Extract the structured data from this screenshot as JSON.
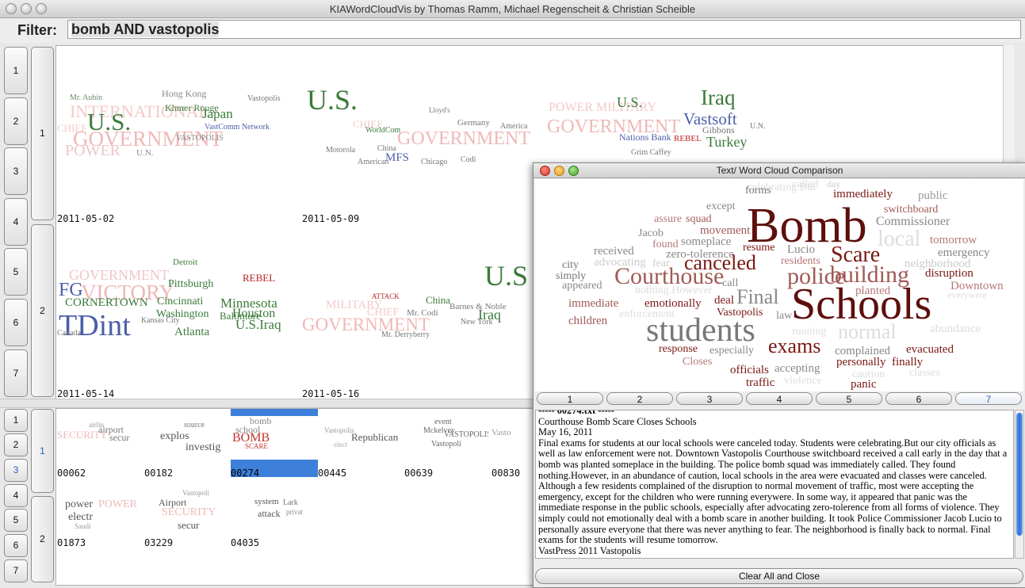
{
  "window": {
    "title": "KIAWordCloudVis by Thomas Ramm, Michael Regenscheit & Christian Scheible"
  },
  "filter": {
    "label": "Filter:",
    "value": "bomb AND vastopolis"
  },
  "top_view": {
    "row_buttons": [
      "1",
      "2",
      "3",
      "4",
      "5",
      "6",
      "7"
    ],
    "group_buttons": [
      "1",
      "2"
    ],
    "dates": [
      "2011-05-02",
      "2011-05-09",
      "2011-05-14",
      "2011-05-16"
    ]
  },
  "bottom_view": {
    "row_buttons": [
      "1",
      "2",
      "3",
      "4",
      "5",
      "6",
      "7"
    ],
    "selected_row": "3",
    "group_buttons": [
      "1",
      "2"
    ],
    "doc_ids": [
      "00062",
      "00182",
      "00274",
      "00445",
      "00639",
      "00830",
      "01873",
      "03229",
      "04035"
    ],
    "selected_doc": "00274"
  },
  "comparison": {
    "title": "Text/ Word Cloud Comparison",
    "tabs": [
      "1",
      "2",
      "3",
      "4",
      "5",
      "6",
      "7"
    ],
    "active_tab": "7",
    "doc_header": "----- 00274.txt -----",
    "headline": "Courthouse Bomb Scare Closes Schools",
    "date": "May 16, 2011",
    "body": "Final exams for students at our local schools were canceled today. Students were celebrating.But our city officials as well as law enforcement were not. Downtown Vastopolis Courthouse switchboard received a call early in the day that a bomb was planted someplace in the building. The police bomb squad was immediately called. They found nothing.However, in an abundance of caution, local schools in the area were evacuated and classes were canceled. Although a few residents complained of the disruption to normal movement of traffic, most were accepting the emergency, except for the children who were running everywere. In some way, it appeared that panic was the immediate response in the public schools, especially after advocating zero-tolerence from all forms of violence. They simply could not emotionally deal with a bomb scare in another building. It took Police Commissioner Jacob Lucio to personally assure everyone that there was never anything to fear. The neighborhood is finally back to normal. Final exams for the students will resume tomorrow.",
    "footer": "VastPress 2011 Vastopolis",
    "close_label": "Clear All and Close"
  },
  "colors": {
    "accent": "#3d7fd9",
    "dark_red": "#7a1712",
    "green": "#3a7a3a",
    "blue": "#4a5fa8",
    "pink": "#f0b4b4",
    "grey": "#777777"
  }
}
